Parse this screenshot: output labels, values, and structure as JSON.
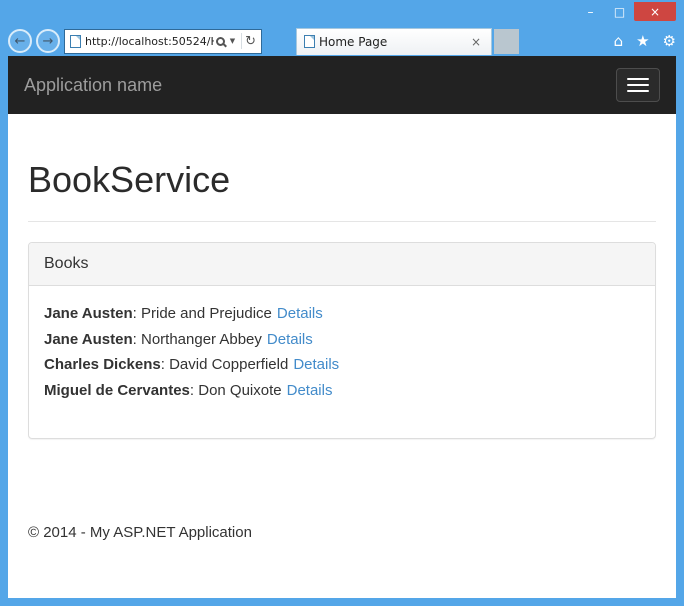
{
  "colors": {
    "frame_blue": "#54a6e8",
    "close_button_red": "#ce4641",
    "navbar_bg": "#222222",
    "brand_text": "#9d9d9d",
    "link_blue": "#428bca",
    "panel_border": "#dddddd",
    "panel_heading_bg": "#f5f5f5"
  },
  "browser": {
    "address": "http://localhost:50524/H",
    "tab_title": "Home Page",
    "icons": {
      "minimize": "–",
      "maximize": "□",
      "close": "×",
      "back": "←",
      "forward": "→",
      "dropdown": "▼",
      "refresh": "↻",
      "tab_close": "×",
      "home": "⌂",
      "favorites": "★",
      "settings": "⚙"
    }
  },
  "page": {
    "navbar": {
      "brand": "Application name"
    },
    "title": "BookService",
    "panel": {
      "header": "Books",
      "separator": ": ",
      "books": [
        {
          "author": "Jane Austen",
          "title": "Pride and Prejudice",
          "details_label": "Details"
        },
        {
          "author": "Jane Austen",
          "title": "Northanger Abbey",
          "details_label": "Details"
        },
        {
          "author": "Charles Dickens",
          "title": "David Copperfield",
          "details_label": "Details"
        },
        {
          "author": "Miguel de Cervantes",
          "title": "Don Quixote",
          "details_label": "Details"
        }
      ]
    },
    "footer": "© 2014 - My ASP.NET Application"
  }
}
